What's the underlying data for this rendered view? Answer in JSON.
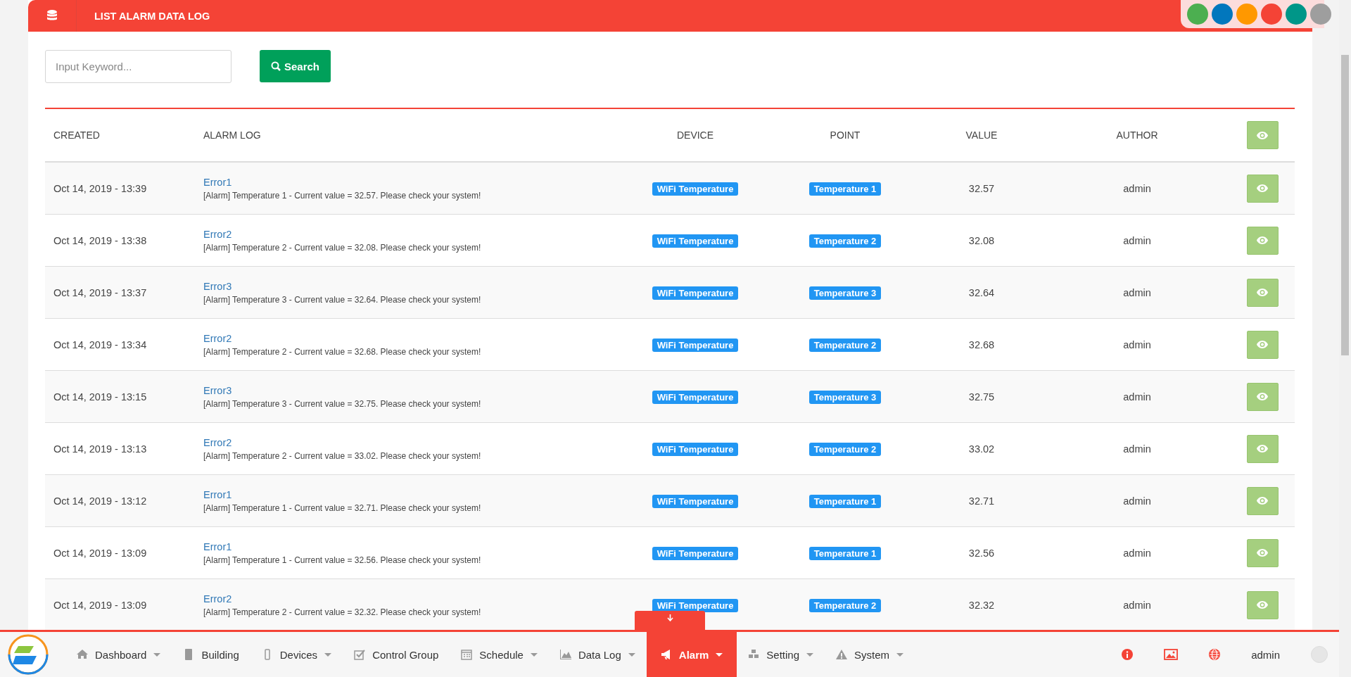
{
  "header": {
    "title": "LIST ALARM DATA LOG"
  },
  "theme_colors": [
    {
      "color": "#4caf50"
    },
    {
      "color": "#0277bd"
    },
    {
      "color": "#ff9800"
    },
    {
      "color": "#f44336"
    },
    {
      "color": "#009688"
    },
    {
      "color": "#9e9e9e"
    }
  ],
  "search": {
    "placeholder": "Input Keyword...",
    "button": "Search"
  },
  "table": {
    "columns": [
      "CREATED",
      "ALARM LOG",
      "DEVICE",
      "POINT",
      "VALUE",
      "AUTHOR"
    ],
    "rows": [
      {
        "created": "Oct 14, 2019 - 13:39",
        "title": "Error1",
        "message": "[Alarm] Temperature 1 - Current value = 32.57. Please check your system!",
        "device": "WiFi Temperature",
        "point": "Temperature 1",
        "value": "32.57",
        "author": "admin"
      },
      {
        "created": "Oct 14, 2019 - 13:38",
        "title": "Error2",
        "message": "[Alarm] Temperature 2 - Current value = 32.08. Please check your system!",
        "device": "WiFi Temperature",
        "point": "Temperature 2",
        "value": "32.08",
        "author": "admin"
      },
      {
        "created": "Oct 14, 2019 - 13:37",
        "title": "Error3",
        "message": "[Alarm] Temperature 3 - Current value = 32.64. Please check your system!",
        "device": "WiFi Temperature",
        "point": "Temperature 3",
        "value": "32.64",
        "author": "admin"
      },
      {
        "created": "Oct 14, 2019 - 13:34",
        "title": "Error2",
        "message": "[Alarm] Temperature 2 - Current value = 32.68. Please check your system!",
        "device": "WiFi Temperature",
        "point": "Temperature 2",
        "value": "32.68",
        "author": "admin"
      },
      {
        "created": "Oct 14, 2019 - 13:15",
        "title": "Error3",
        "message": "[Alarm] Temperature 3 - Current value = 32.75. Please check your system!",
        "device": "WiFi Temperature",
        "point": "Temperature 3",
        "value": "32.75",
        "author": "admin"
      },
      {
        "created": "Oct 14, 2019 - 13:13",
        "title": "Error2",
        "message": "[Alarm] Temperature 2 - Current value = 33.02. Please check your system!",
        "device": "WiFi Temperature",
        "point": "Temperature 2",
        "value": "33.02",
        "author": "admin"
      },
      {
        "created": "Oct 14, 2019 - 13:12",
        "title": "Error1",
        "message": "[Alarm] Temperature 1 - Current value = 32.71. Please check your system!",
        "device": "WiFi Temperature",
        "point": "Temperature 1",
        "value": "32.71",
        "author": "admin"
      },
      {
        "created": "Oct 14, 2019 - 13:09",
        "title": "Error1",
        "message": "[Alarm] Temperature 1 - Current value = 32.56. Please check your system!",
        "device": "WiFi Temperature",
        "point": "Temperature 1",
        "value": "32.56",
        "author": "admin"
      },
      {
        "created": "Oct 14, 2019 - 13:09",
        "title": "Error2",
        "message": "[Alarm] Temperature 2 - Current value = 32.32. Please check your system!",
        "device": "WiFi Temperature",
        "point": "Temperature 2",
        "value": "32.32",
        "author": "admin"
      }
    ]
  },
  "nav": {
    "items": [
      {
        "label": "Dashboard",
        "selected": false,
        "dropdown": true
      },
      {
        "label": "Building",
        "selected": false,
        "dropdown": false
      },
      {
        "label": "Devices",
        "selected": false,
        "dropdown": true
      },
      {
        "label": "Control Group",
        "selected": false,
        "dropdown": false
      },
      {
        "label": "Schedule",
        "selected": false,
        "dropdown": true
      },
      {
        "label": "Data Log",
        "selected": false,
        "dropdown": true
      },
      {
        "label": "Alarm",
        "selected": true,
        "dropdown": true
      },
      {
        "label": "Setting",
        "selected": false,
        "dropdown": true
      },
      {
        "label": "System",
        "selected": false,
        "dropdown": true
      }
    ],
    "user": "admin"
  }
}
